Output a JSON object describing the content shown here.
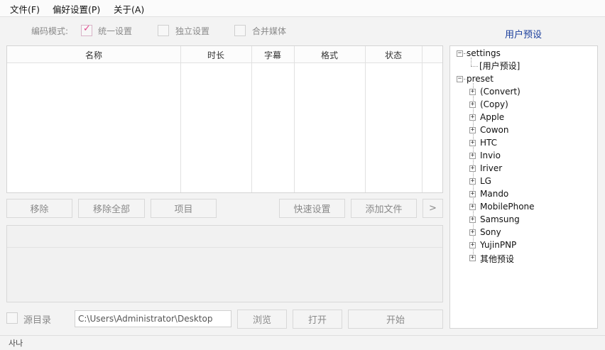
{
  "menu": {
    "items": [
      {
        "label": "文件(F)"
      },
      {
        "label": "偏好设置(P)"
      },
      {
        "label": "关于(A)"
      }
    ]
  },
  "mode": {
    "label": "编码模式:",
    "options": [
      {
        "label": "统一设置",
        "checked": true
      },
      {
        "label": "独立设置",
        "checked": false
      },
      {
        "label": "合并媒体",
        "checked": false
      }
    ]
  },
  "table": {
    "columns": [
      "名称",
      "时长",
      "字幕",
      "格式",
      "状态"
    ]
  },
  "buttons": {
    "remove": "移除",
    "remove_all": "移除全部",
    "item": "项目",
    "quick_settings": "快速设置",
    "add_file": "添加文件",
    "more": ">",
    "browse": "浏览",
    "open": "打开",
    "start": "开始"
  },
  "output": {
    "source_dir_label": "源目录",
    "source_dir_checked": false,
    "path": "C:\\Users\\Administrator\\Desktop"
  },
  "preset_panel": {
    "title": "用户预设",
    "tree": {
      "settings": {
        "label": "settings",
        "children": [
          "[用户预设]"
        ]
      },
      "preset": {
        "label": "preset",
        "children": [
          "(Convert)",
          "(Copy)",
          "Apple",
          "Cowon",
          "HTC",
          "Invio",
          "Iriver",
          "LG",
          "Mando",
          "MobilePhone",
          "Samsung",
          "Sony",
          "YujinPNP",
          "其他预设"
        ]
      }
    }
  },
  "status": {
    "text": "사나"
  },
  "colors": {
    "accent_title": "#1a3e9c",
    "checkmark": "#e3478d"
  }
}
